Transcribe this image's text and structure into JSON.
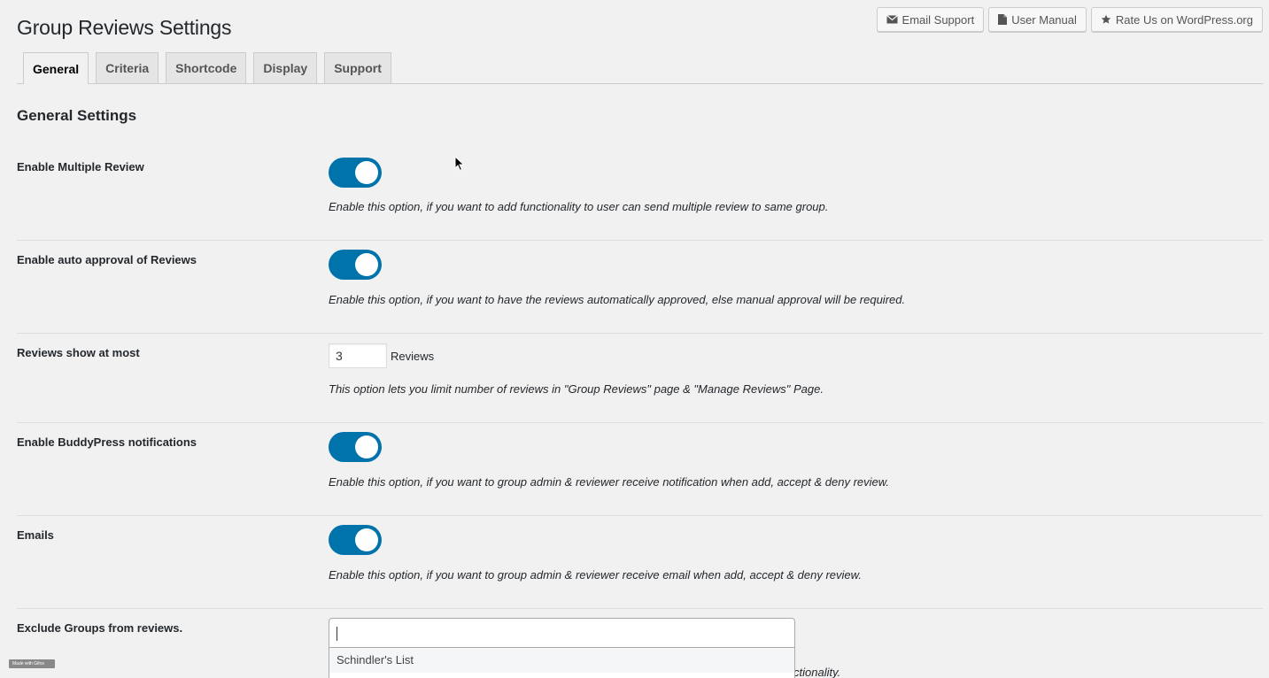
{
  "page_title": "Group Reviews Settings",
  "top_actions": [
    {
      "label": "Email Support",
      "icon": "envelope-icon"
    },
    {
      "label": "User Manual",
      "icon": "document-icon"
    },
    {
      "label": "Rate Us on WordPress.org",
      "icon": "star-icon"
    }
  ],
  "tabs": [
    {
      "label": "General",
      "active": true
    },
    {
      "label": "Criteria",
      "active": false
    },
    {
      "label": "Shortcode",
      "active": false
    },
    {
      "label": "Display",
      "active": false
    },
    {
      "label": "Support",
      "active": false
    }
  ],
  "section_title": "General Settings",
  "settings": {
    "multiple_review": {
      "label": "Enable Multiple Review",
      "enabled": true,
      "description": "Enable this option, if you want to add functionality to user can send multiple review to same group."
    },
    "auto_approval": {
      "label": "Enable auto approval of Reviews",
      "enabled": true,
      "description": "Enable this option, if you want to have the reviews automatically approved, else manual approval will be required."
    },
    "reviews_limit": {
      "label": "Reviews show at most",
      "value": "3",
      "unit": "Reviews",
      "description": "This option lets you limit number of reviews in \"Group Reviews\" page & \"Manage Reviews\" Page."
    },
    "buddypress_notifications": {
      "label": "Enable BuddyPress notifications",
      "enabled": true,
      "description": "Enable this option, if you want to group admin & reviewer receive notification when add, accept & deny review."
    },
    "emails": {
      "label": "Emails",
      "enabled": true,
      "description": "Enable this option, if you want to group admin & reviewer receive email when add, accept & deny review."
    },
    "exclude_groups": {
      "label": "Exclude Groups from reviews.",
      "input_value": "",
      "options": [
        "Schindler's List"
      ],
      "description_fragment": "ctionality."
    }
  },
  "badge_text": "Made with Gifox",
  "colors": {
    "toggle_on": "#0073aa",
    "background": "#f1f1f1"
  }
}
